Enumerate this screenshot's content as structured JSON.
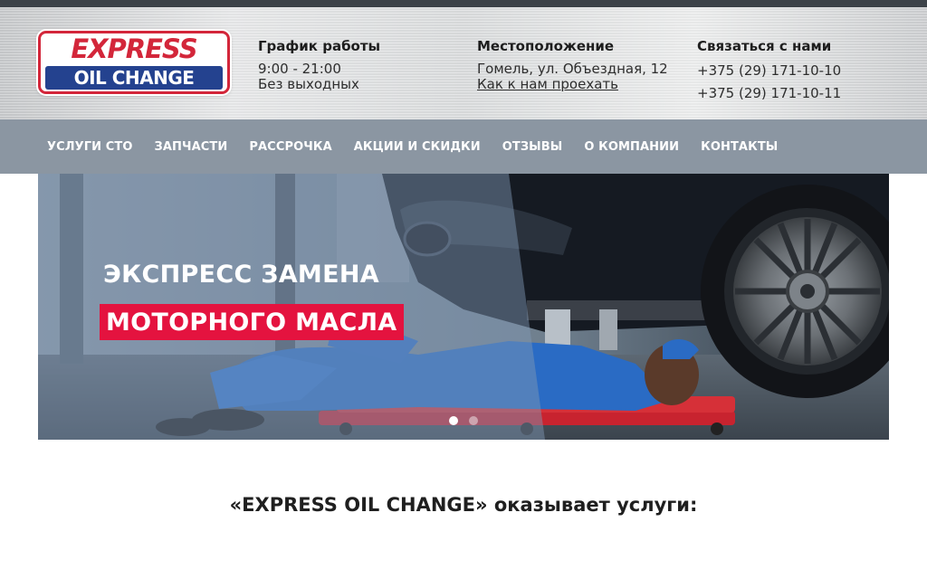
{
  "logo": {
    "line1": "EXPRESS",
    "line2": "OIL CHANGE",
    "colors": {
      "red": "#d3263a",
      "blue": "#24428f"
    }
  },
  "header": {
    "schedule": {
      "title": "График работы",
      "hours": "9:00 - 21:00",
      "days": "Без выходных"
    },
    "location": {
      "title": "Местоположение",
      "address": "Гомель, ул. Объездная, 12",
      "directions_link": "Как к нам проехать"
    },
    "contacts": {
      "title": "Связаться с нами",
      "phone1": "+375 (29) 171-10-10",
      "phone2": "+375 (29) 171-10-11"
    }
  },
  "nav": {
    "items": [
      "УСЛУГИ СТО",
      "ЗАПЧАСТИ",
      "РАССРОЧКА",
      "АКЦИИ И СКИДКИ",
      "ОТЗЫВЫ",
      "О КОМПАНИИ",
      "КОНТАКТЫ"
    ],
    "background": "#8b96a2"
  },
  "hero": {
    "line1": "ЭКСПРЕСС ЗАМЕНА",
    "line2": "МОТОРНОГО МАСЛА",
    "accent": "#e4133f",
    "slides_count": 2,
    "active_slide": 1
  },
  "services": {
    "heading": "«EXPRESS OIL CHANGE» оказывает услуги:"
  }
}
